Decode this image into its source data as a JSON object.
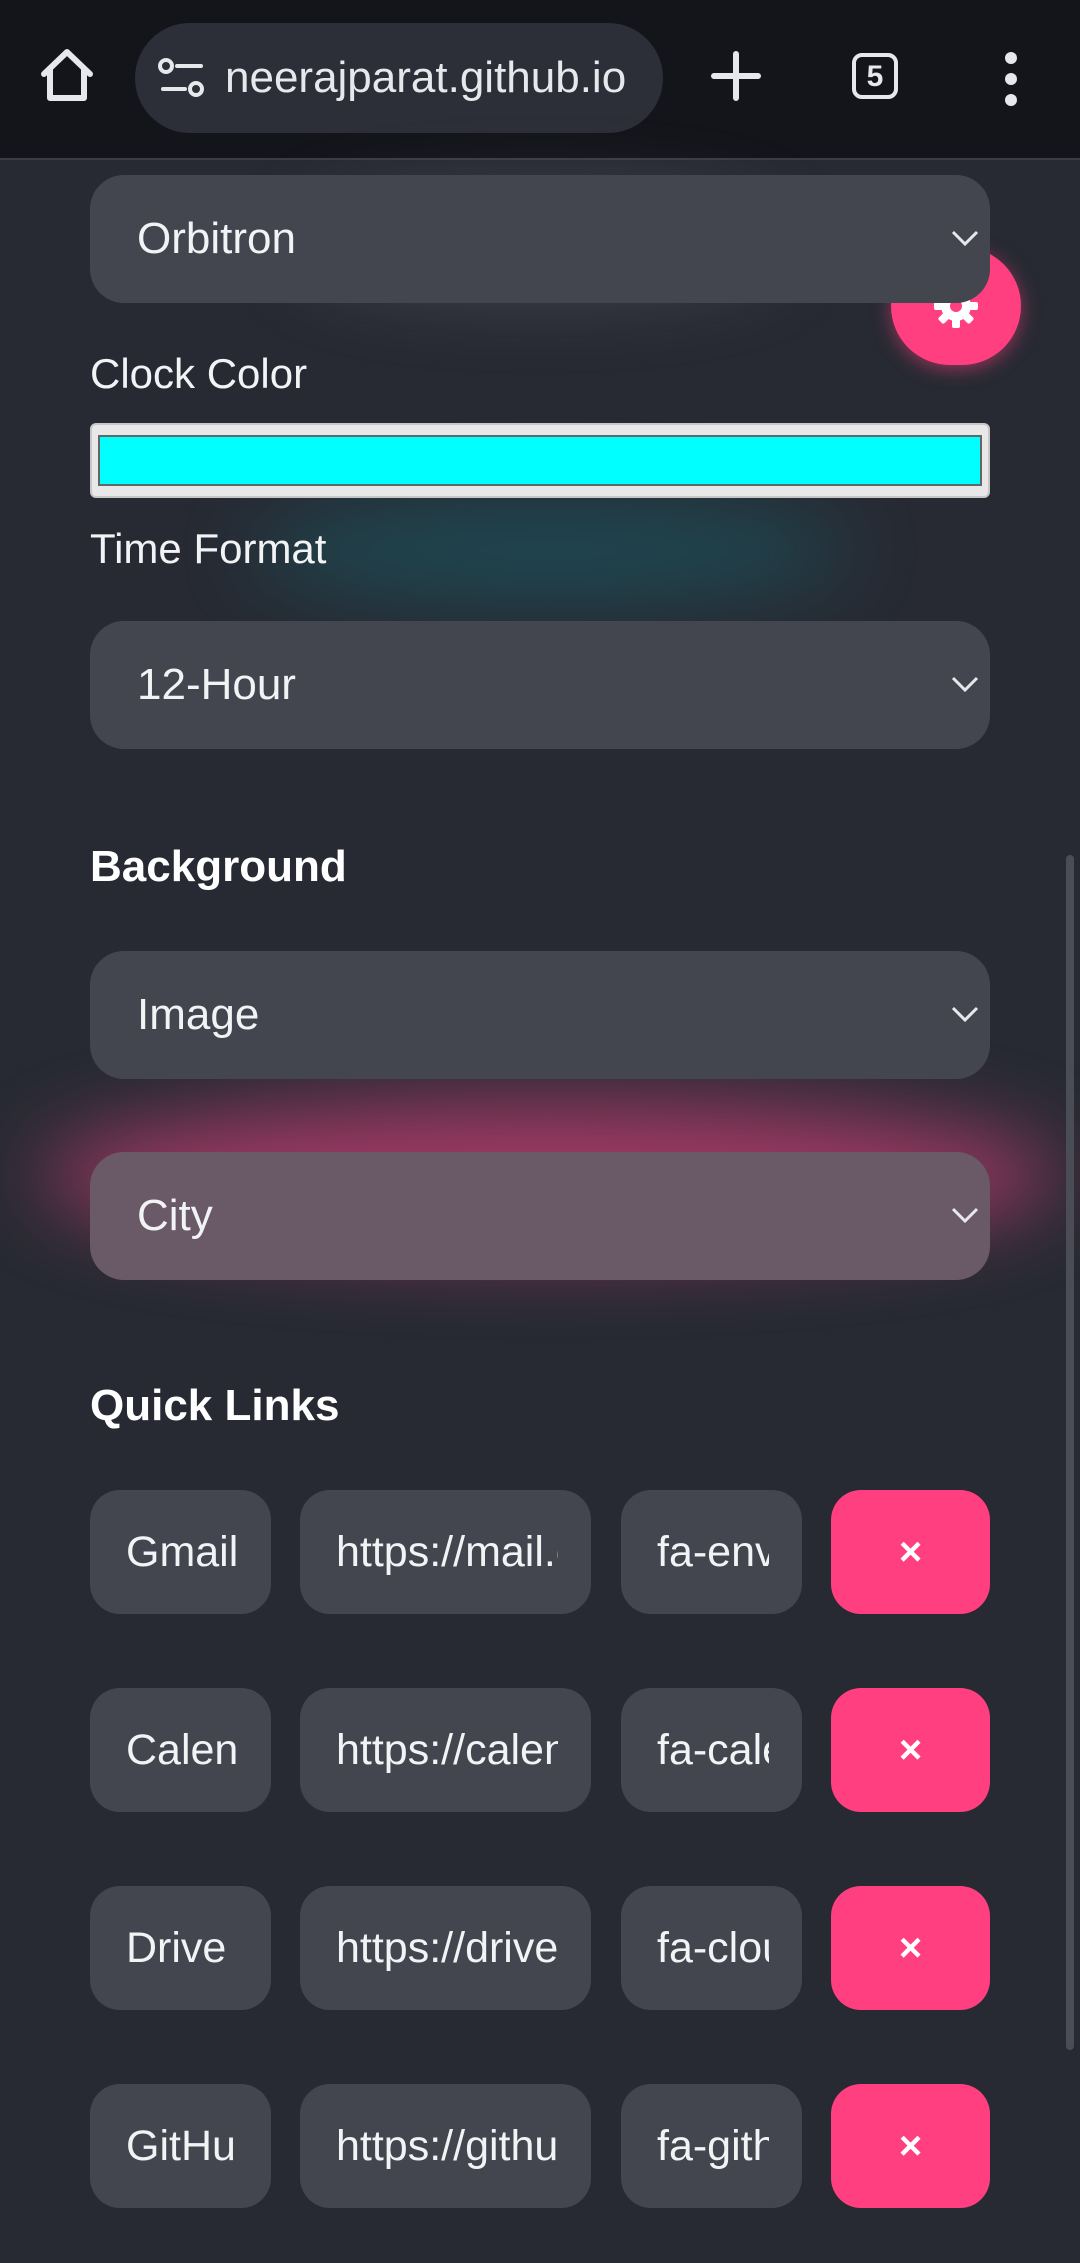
{
  "browser": {
    "url": "neerajparat.github.io",
    "tab_count": "5"
  },
  "settings": {
    "font_select": "Orbitron",
    "clock_color_label": "Clock Color",
    "clock_color_value": "#00ffff",
    "time_format_label": "Time Format",
    "time_format_select": "12-Hour",
    "background_heading": "Background",
    "background_type_select": "Image",
    "background_image_select": "City",
    "quick_links_heading": "Quick Links"
  },
  "quick_links": [
    {
      "name": "Gmail",
      "url": "https://mail.google.com",
      "icon": "fa-envelope",
      "delete_label": "×"
    },
    {
      "name": "Calendar",
      "url": "https://calendar.google.com",
      "icon": "fa-calendar",
      "delete_label": "×"
    },
    {
      "name": "Drive",
      "url": "https://drive.google.com",
      "icon": "fa-cloud",
      "delete_label": "×"
    },
    {
      "name": "GitHub",
      "url": "https://github.com",
      "icon": "fa-github",
      "delete_label": "×"
    }
  ],
  "colors": {
    "accent": "#ff3f7f",
    "background": "#272a33",
    "field": "#43464f"
  }
}
